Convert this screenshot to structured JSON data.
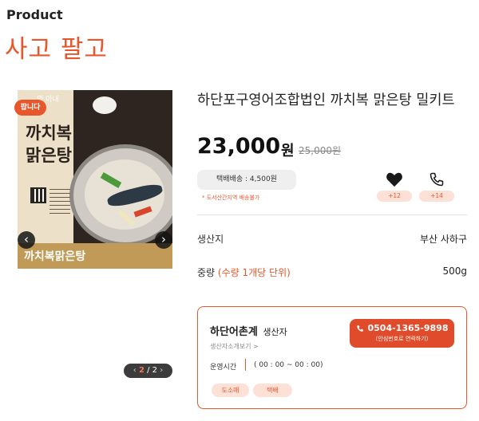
{
  "section": {
    "label": "Product",
    "title": "사고 팔고"
  },
  "gallery": {
    "badge": "팝니다",
    "image_texts": {
      "head": "의 아내",
      "line1": "까치복",
      "line2": "맑은탕",
      "caption": "까치복맑은탕"
    },
    "prev_icon": "‹",
    "next_icon": "›",
    "pager": {
      "current": "2",
      "separator": "/",
      "total": "2"
    }
  },
  "product": {
    "name": "하단포구영어조합법인 까치복 맑은탕 밀키트",
    "price": "23,000",
    "currency": "원",
    "original_price": "25,000원",
    "shipping": "택배배송 : 4,500원",
    "shipping_note": "* 도서산간지역 배송불가",
    "like_count": "+12",
    "call_count": "+14"
  },
  "details": {
    "origin_label": "생산지",
    "origin_value": "부산 사하구",
    "weight_label": "중량",
    "weight_hint": "(수량 1개당 단위)",
    "weight_value": "500g"
  },
  "seller": {
    "name": "하단어촌계",
    "role": "생산자",
    "intro_link": "생산자소개보기 >",
    "phone": "0504-1365-9898",
    "phone_sub": "(안심번호로 연락하기)",
    "hours_label": "운영시간",
    "hours_value": "( 00 : 00 ~ 00 : 00)",
    "tags": [
      "도소매",
      "택배"
    ]
  },
  "colors": {
    "accent": "#e8572c",
    "accent_soft": "#fde0d6",
    "call_button": "#e04c2b"
  }
}
